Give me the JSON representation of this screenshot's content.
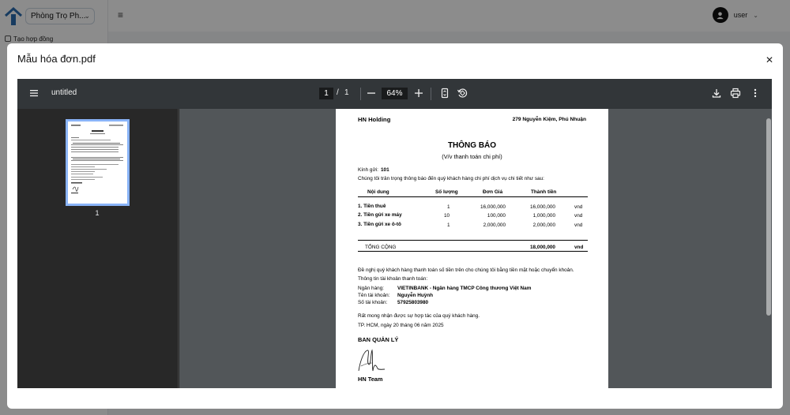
{
  "app": {
    "property_select": "Phòng Trọ Ph...",
    "nav_first_item": "Tạo hợp đồng",
    "user_name": "user"
  },
  "modal": {
    "title": "Mẫu hóa đơn.pdf"
  },
  "viewer": {
    "doc_title": "untitled",
    "current_page": "1",
    "total_pages": "1",
    "zoom": "64%",
    "thumbnail_label": "1"
  },
  "invoice": {
    "company": "HN Holding",
    "address": "279 Nguyễn Kiệm, Phú Nhuận",
    "title": "THÔNG BÁO",
    "subtitle": "(V/v thanh toán chi phí)",
    "to_label": "Kính gửi:",
    "to_value": "101",
    "intro": "Chúng tôi trân trọng thông báo đến quý khách hàng chi phí dịch vụ chi tiết như sau:",
    "headers": [
      "Nội dung",
      "Số lượng",
      "Đơn Giá",
      "Thành tiền"
    ],
    "rows": [
      {
        "name": "1. Tiền thuê",
        "qty": "1",
        "price": "16,000,000",
        "total": "16,000,000",
        "unit": "vnd"
      },
      {
        "name": "2. Tiền gửi xe máy",
        "qty": "10",
        "price": "100,000",
        "total": "1,000,000",
        "unit": "vnd"
      },
      {
        "name": "3. Tiền gửi xe ô-tô",
        "qty": "1",
        "price": "2,000,000",
        "total": "2,000,000",
        "unit": "vnd"
      }
    ],
    "grand_label": "TỔNG CỘNG",
    "grand_total": "18,000,000",
    "grand_unit": "vnd",
    "request": "Đề nghị quý khách hàng thanh toán số tiền trên cho chúng tôi bằng tiền mặt hoặc chuyển khoản.",
    "bank_info_title": "Thông tin tài khoản thanh toán:",
    "bank_label": "Ngân hàng:",
    "bank_value": "VIETINBANK - Ngân hàng TMCP Công thương Việt Nam",
    "holder_label": "Tên tài khoản:",
    "holder_value": "Nguyễn Huỳnh",
    "account_label": "Số tài khoản:",
    "account_value": "57925803980",
    "thanks": "Rất mong nhận được sự hợp tác của quý khách hàng.",
    "date_line": "TP. HCM, ngày 20 tháng 06 năm 2025",
    "board": "BAN QUẢN LÝ",
    "signer": "HN Team"
  },
  "colors": {
    "toolbar": "#323639",
    "viewer_bg": "#525659",
    "thumb_border": "#8ab4f8"
  },
  "icons": [
    "menu-icon",
    "minus-icon",
    "plus-icon",
    "fit-page-icon",
    "rotate-icon",
    "download-icon",
    "print-icon",
    "more-vert-icon",
    "close-icon",
    "user-icon",
    "chevron-down-icon"
  ]
}
